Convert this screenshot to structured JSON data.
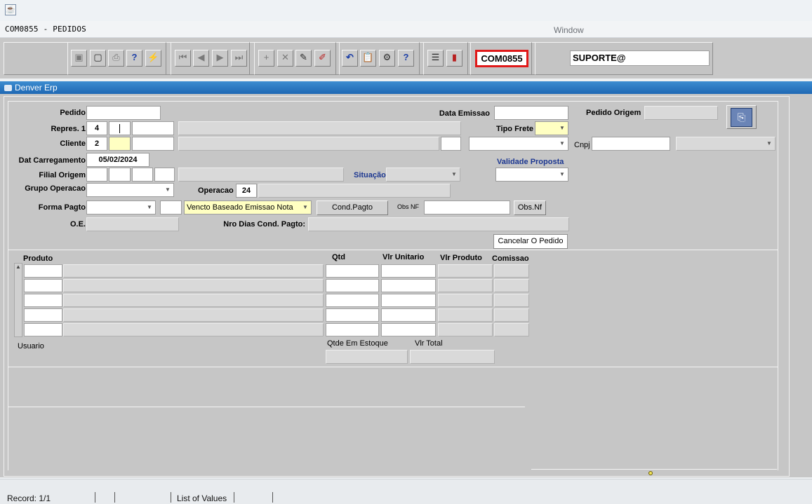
{
  "window": {
    "title": "COM0855 - PEDIDOS",
    "menu_window": "Window"
  },
  "toolbar": {
    "save_icon": "save-icon",
    "print_icon": "print-icon",
    "first_record": "first-record-icon",
    "last_record": "last-record-icon",
    "form_code": "COM0855",
    "user": "SUPORTE@"
  },
  "panel": {
    "title": "Denver Erp"
  },
  "form": {
    "pedido_label": "Pedido",
    "data_emissao_label": "Data Emissao",
    "pedido_origem_label": "Pedido Origem",
    "repres_label": "Repres. 1",
    "repres_value": "4",
    "tipo_frete_label": "Tipo Frete",
    "cliente_label": "Cliente",
    "cliente_value": "2",
    "cnpj_label": "Cnpj",
    "dat_carregamento_label": "Dat Carregamento",
    "dat_carregamento_value": "05/02/2024",
    "validade_proposta_label": "Validade Proposta",
    "filial_origem_label": "Filial Origem",
    "situacao_label": "Situação",
    "grupo_operacao_label": "Grupo Operacao",
    "operacao_label": "Operacao",
    "operacao_value": "24",
    "forma_pagto_label": "Forma Pagto",
    "vencto_value": "Vencto Baseado Emissao Nota",
    "cond_pagto_button": "Cond.Pagto",
    "obs_nf_small_label": "Obs NF",
    "obs_nf_button": "Obs.Nf",
    "oe_label": "O.E.",
    "nro_dias_label": "Nro Dias Cond. Pagto:",
    "cancelar_button": "Cancelar O Pedido"
  },
  "grid": {
    "headers": {
      "produto": "Produto",
      "qtd": "Qtd",
      "vlr_unitario": "Vlr Unitario",
      "vlr_produto": "Vlr Produto",
      "comissao": "Comissao"
    },
    "usuario_label": "Usuario",
    "qtde_estoque_label": "Qtde Em Estoque",
    "vlr_total_label": "Vlr Total"
  },
  "status": {
    "record": "Record: 1/1",
    "lov": "List of Values"
  }
}
